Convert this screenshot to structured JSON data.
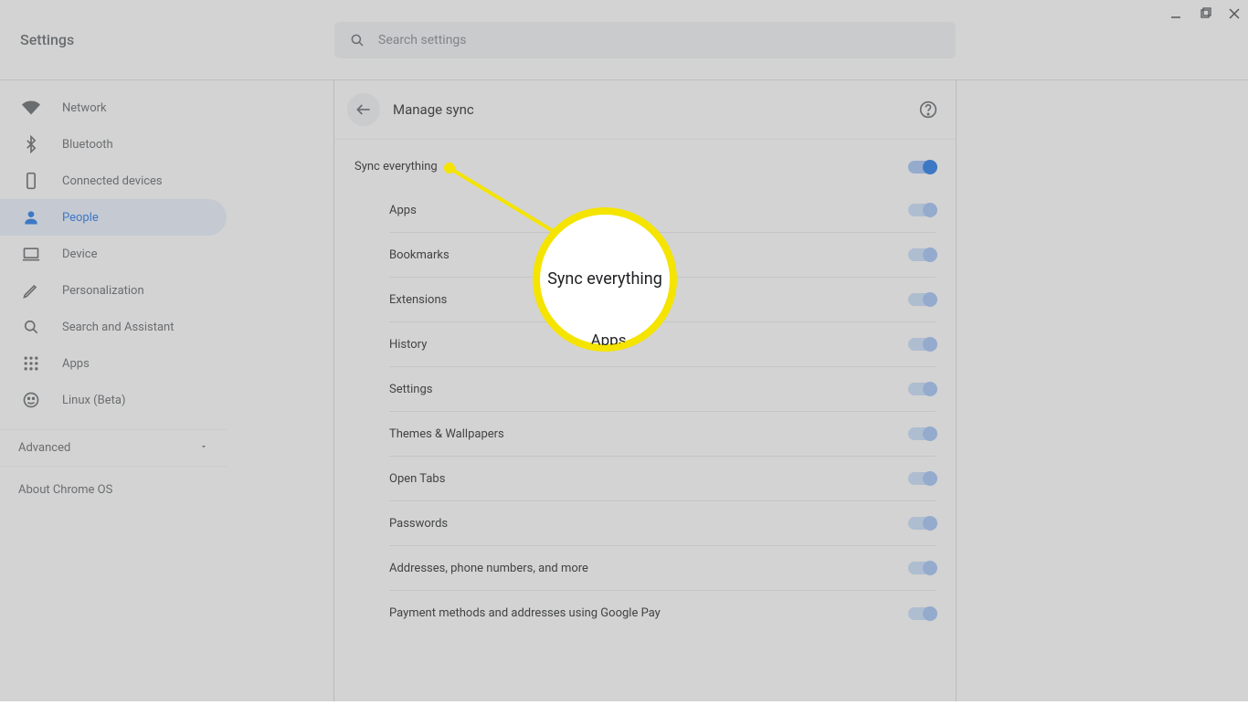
{
  "app_title": "Settings",
  "search": {
    "placeholder": "Search settings"
  },
  "sidebar": {
    "items": [
      {
        "label": "Network"
      },
      {
        "label": "Bluetooth"
      },
      {
        "label": "Connected devices"
      },
      {
        "label": "People"
      },
      {
        "label": "Device"
      },
      {
        "label": "Personalization"
      },
      {
        "label": "Search and Assistant"
      },
      {
        "label": "Apps"
      },
      {
        "label": "Linux (Beta)"
      }
    ],
    "advanced": "Advanced",
    "about": "About Chrome OS"
  },
  "page": {
    "title": "Manage sync",
    "master": {
      "label": "Sync everything",
      "on": true,
      "enabled": true
    },
    "items": [
      {
        "label": "Apps"
      },
      {
        "label": "Bookmarks"
      },
      {
        "label": "Extensions"
      },
      {
        "label": "History"
      },
      {
        "label": "Settings"
      },
      {
        "label": "Themes & Wallpapers"
      },
      {
        "label": "Open Tabs"
      },
      {
        "label": "Passwords"
      },
      {
        "label": "Addresses, phone numbers, and more"
      },
      {
        "label": "Payment methods and addresses using Google Pay"
      }
    ]
  },
  "annotation": {
    "text_primary": "Sync everything",
    "text_secondary": "Apps"
  }
}
